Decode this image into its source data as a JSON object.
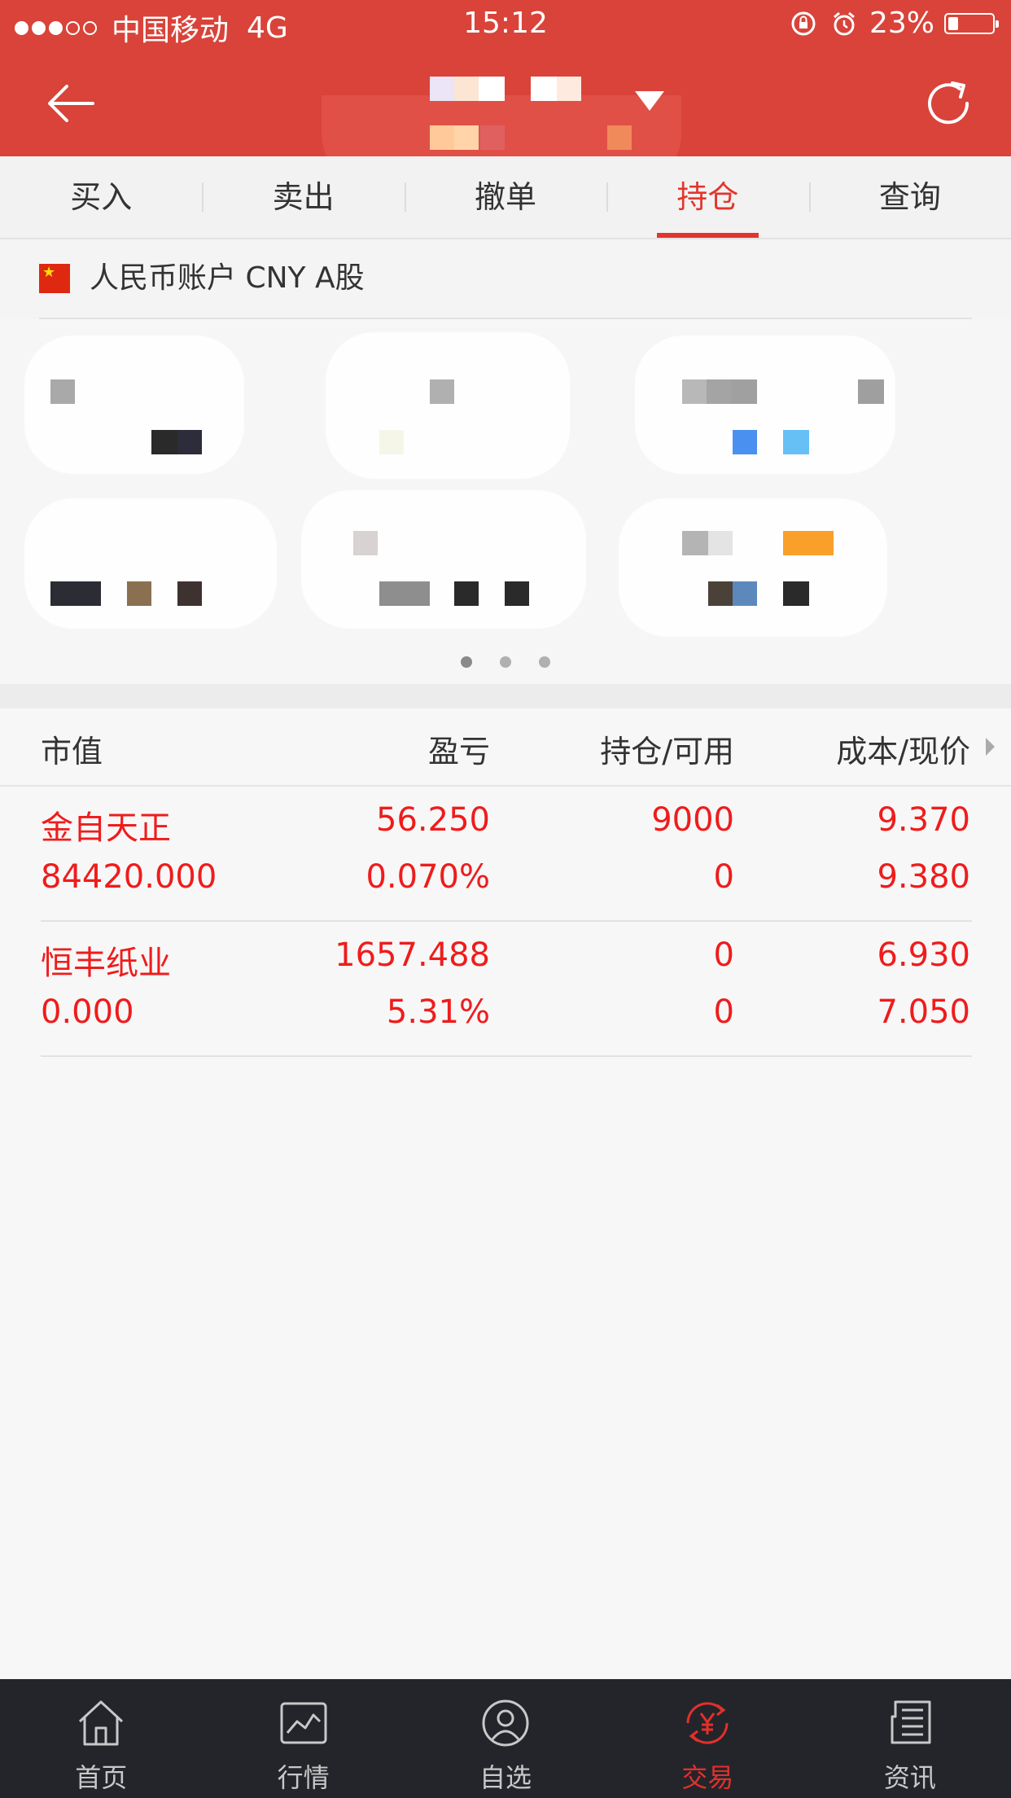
{
  "status_bar": {
    "signal_dots": [
      "full",
      "full",
      "full",
      "empty",
      "empty"
    ],
    "carrier": "中国移动",
    "network": "4G",
    "time": "15:12",
    "battery_percent": "23%",
    "battery_level": 0.23
  },
  "nav": {
    "back_icon": "arrow-left-icon",
    "refresh_icon": "refresh-icon",
    "title_redacted": true
  },
  "tabs": [
    {
      "label": "买入",
      "active": false
    },
    {
      "label": "卖出",
      "active": false
    },
    {
      "label": "撤单",
      "active": false
    },
    {
      "label": "持仓",
      "active": true
    },
    {
      "label": "查询",
      "active": false
    }
  ],
  "account": {
    "flag": "china-flag-icon",
    "label": "人民币账户 CNY A股"
  },
  "summary": {
    "pager": {
      "pages": 3,
      "current": 1
    }
  },
  "holdings": {
    "headers": {
      "market_value": "市值",
      "pnl": "盈亏",
      "position": "持仓/可用",
      "price": "成本/现价"
    },
    "rows": [
      {
        "name": "金自天正",
        "value": "84420.000",
        "pnl": "56.250",
        "pnl_pct": "0.070%",
        "held": "9000",
        "available": "0",
        "cost": "9.370",
        "price": "9.380"
      },
      {
        "name": "恒丰纸业",
        "value": "0.000",
        "pnl": "1657.488",
        "pnl_pct": "5.31%",
        "held": "0",
        "available": "0",
        "cost": "6.930",
        "price": "7.050"
      }
    ]
  },
  "bottom_nav": [
    {
      "label": "首页",
      "icon": "home-icon",
      "active": false
    },
    {
      "label": "行情",
      "icon": "chart-icon",
      "active": false
    },
    {
      "label": "自选",
      "icon": "watchlist-icon",
      "active": false
    },
    {
      "label": "交易",
      "icon": "trade-yen-icon",
      "active": true
    },
    {
      "label": "资讯",
      "icon": "news-icon",
      "active": false
    }
  ],
  "colors": {
    "brand_red": "#d94339",
    "accent_red": "#e2362d",
    "value_red": "#ef1c1c",
    "tabbar_bg": "#24252b"
  }
}
